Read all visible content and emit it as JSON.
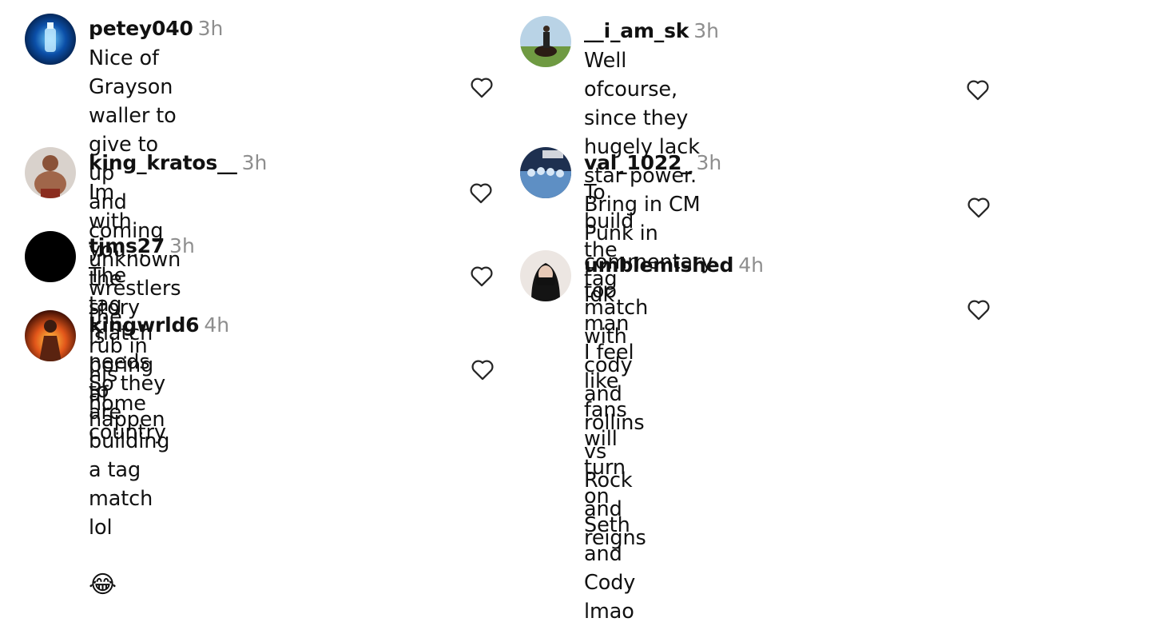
{
  "comments": [
    {
      "username": "petey040",
      "time": "3h",
      "text": "Nice of Grayson waller to give to up\nand coming unknown wrestlers the\nrub in his home country",
      "avatar_icon": "blue-bottle-avatar",
      "heart_icon": "heart-outline-icon"
    },
    {
      "username": "king_kratos__",
      "time": "3h",
      "text": "Im with you... the story is boring af",
      "avatar_icon": "wrestler-avatar",
      "heart_icon": "heart-outline-icon"
    },
    {
      "username": "tjms27",
      "time": "3h",
      "text": "The tag match needs to happen",
      "avatar_icon": "black-avatar",
      "heart_icon": "heart-outline-icon"
    },
    {
      "username": "kingwrld6",
      "time": "4h",
      "text": "So they are building a tag match lol",
      "emoji": "😂",
      "avatar_icon": "fire-figure-avatar",
      "heart_icon": "heart-outline-icon"
    },
    {
      "username": "__i_am_sk",
      "time": "3h",
      "text": "Well ofcourse, since they hugely lack\nstar power. Bring in CM Punk in\ncommentary too",
      "avatar_icon": "horse-rider-avatar",
      "heart_icon": "heart-outline-icon"
    },
    {
      "username": "val_1022_",
      "time": "3h",
      "text": "To build the tag match with cody and\nrollins vs Rock and reigns",
      "avatar_icon": "team-celebration-avatar",
      "heart_icon": "heart-outline-icon"
    },
    {
      "username": "umblemished",
      "time": "4h",
      "text": "Idk man I feel like fans will turn on\nSeth and Cody lmao",
      "avatar_icon": "woman-portrait-avatar",
      "heart_icon": "heart-outline-icon"
    }
  ],
  "colors": {
    "username": "#111111",
    "timestamp": "#8e8e8e",
    "heart": "#262626"
  }
}
